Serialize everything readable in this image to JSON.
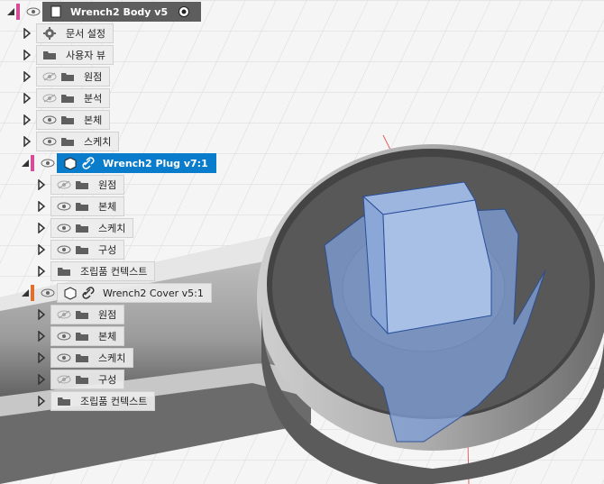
{
  "root": {
    "title": "Wrench2 Body v5",
    "marker_color": "#d64c9a"
  },
  "root_children": [
    {
      "label": "문서 설정",
      "icon": "gear-icon",
      "eye": "none"
    },
    {
      "label": "사용자 뷰",
      "icon": "folder-icon",
      "eye": "none"
    },
    {
      "label": "원점",
      "icon": "folder-icon",
      "eye": "hidden"
    },
    {
      "label": "분석",
      "icon": "folder-icon",
      "eye": "hidden"
    },
    {
      "label": "본체",
      "icon": "folder-icon",
      "eye": "visible"
    },
    {
      "label": "스케치",
      "icon": "folder-icon",
      "eye": "visible"
    }
  ],
  "plug": {
    "title": "Wrench2 Plug v7:1",
    "marker_color": "#d64c9a",
    "children": [
      {
        "label": "원점",
        "eye": "hidden"
      },
      {
        "label": "본체",
        "eye": "visible"
      },
      {
        "label": "스케치",
        "eye": "visible"
      },
      {
        "label": "구성",
        "eye": "visible"
      },
      {
        "label": "조립품 컨텍스트",
        "eye": "none"
      }
    ]
  },
  "cover": {
    "title": "Wrench2 Cover v5:1",
    "marker_color": "#e07030",
    "children": [
      {
        "label": "원점",
        "eye": "hidden"
      },
      {
        "label": "본체",
        "eye": "visible"
      },
      {
        "label": "스케치",
        "eye": "visible"
      },
      {
        "label": "구성",
        "eye": "hidden"
      },
      {
        "label": "조립품 컨텍스트",
        "eye": "none"
      }
    ]
  },
  "colors": {
    "selection": "#0a7ccc",
    "translucent_body": "#7f9fd6",
    "wrench_metal": "#8a8a8a"
  }
}
